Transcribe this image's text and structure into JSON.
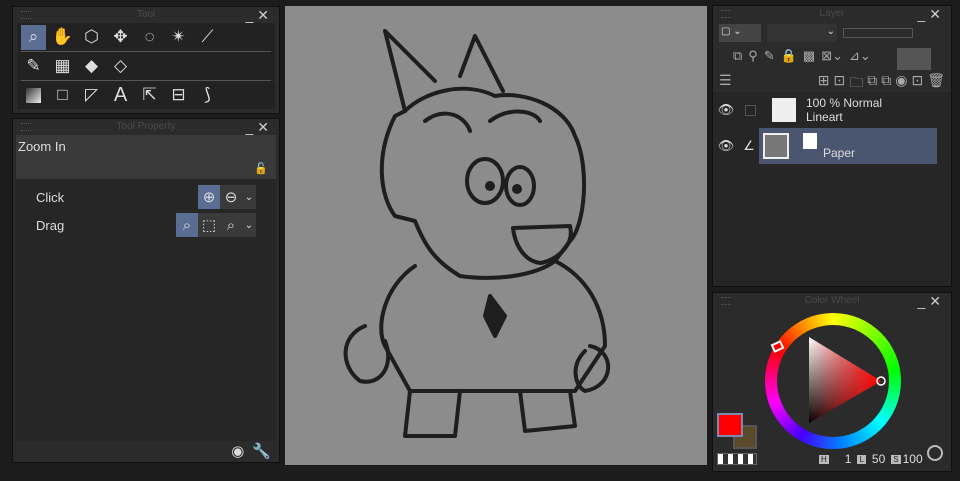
{
  "tool_panel": {
    "title": "Tool",
    "tools_row1": [
      "zoom",
      "hand",
      "object",
      "move",
      "lasso",
      "magic-wand",
      "eyedropper"
    ],
    "tools_row2": [
      "pen",
      "frame",
      "fill",
      "eraser"
    ],
    "tools_row3": [
      "gradient",
      "figure",
      "ruler",
      "text",
      "operation",
      "balloon",
      "correction"
    ]
  },
  "tool_property": {
    "title": "Tool Property",
    "tool_name": "Zoom In",
    "click_label": "Click",
    "drag_label": "Drag"
  },
  "layer_panel": {
    "title": "Layer",
    "layers": [
      {
        "blend": "100 % Normal",
        "name": "Lineart"
      },
      {
        "name": "Paper",
        "selected": true
      }
    ]
  },
  "color_wheel": {
    "title": "Color Wheel",
    "h_label": "H",
    "h_value": "1",
    "l_label": "L",
    "l_value": "50",
    "s_label": "S",
    "s_value": "100",
    "main_color": "#ff0000",
    "sub_color": "#5a4a2a"
  },
  "colors": {
    "accent": "#5a6e94",
    "canvas": "#8c8c8c"
  }
}
